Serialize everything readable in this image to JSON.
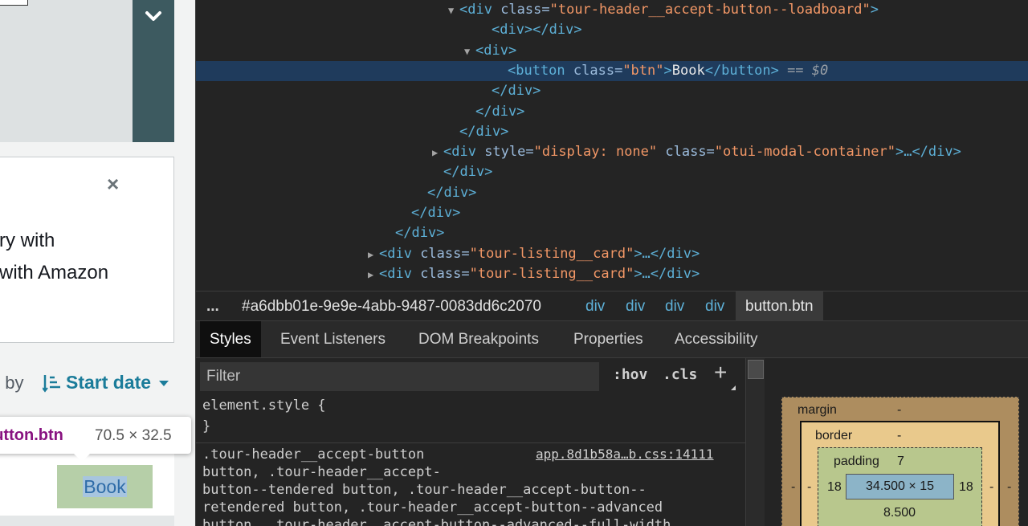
{
  "page": {
    "card": {
      "close_glyph": "×",
      "line1": "ry with",
      "line2": " with Amazon"
    },
    "sort": {
      "label": "t by",
      "value": "Start date"
    },
    "book_button": "Book",
    "tooltip": {
      "element": "button.btn",
      "size": "70.5 × 32.5"
    }
  },
  "devtools": {
    "dom_lines": [
      {
        "tri": "▼",
        "open": "<div",
        "attr": "class",
        "value": "tour-header__accept-button--loadboard",
        "close": ">"
      },
      {
        "raw": "<div></div>"
      },
      {
        "tri": "▼",
        "raw": "<div>"
      },
      {
        "open": "<button",
        "attr": "class",
        "value": "btn",
        "close": ">",
        "text": "Book",
        "end": "</button>",
        "marker": "== $0"
      },
      {
        "raw": "</div>"
      },
      {
        "raw": "</div>"
      },
      {
        "raw": "</div>"
      },
      {
        "tri": "▶",
        "open": "<div",
        "attr": "style",
        "value": "display: none",
        "attr2": "class",
        "value2": "otui-modal-container",
        "close": ">…</div>"
      },
      {
        "raw": "</div>"
      },
      {
        "raw": "</div>"
      },
      {
        "raw": "</div>"
      },
      {
        "raw": "</div>"
      },
      {
        "tri": "▶",
        "open": "<div",
        "attr": "class",
        "value": "tour-listing__card",
        "close": ">…</div>"
      },
      {
        "tri": "▶",
        "open": "<div",
        "attr": "class",
        "value": "tour-listing__card",
        "close": ">…</div>"
      }
    ],
    "ellipsis": "…",
    "breadcrumbs": {
      "more": "...",
      "id": "#a6dbb01e-9e9e-4abb-9487-0083dd6c2070",
      "divs": [
        "div",
        "div",
        "div",
        "div"
      ],
      "active": "button.btn"
    },
    "tabs": [
      "Styles",
      "Event Listeners",
      "DOM Breakpoints",
      "Properties",
      "Accessibility"
    ],
    "styles": {
      "filter_placeholder": "Filter",
      "hov": ":hov",
      "cls": ".cls",
      "plus": "+",
      "element_style_open": "element.style {",
      "element_style_close": "}",
      "selector_lines": [
        ".tour-header__accept-button",
        "button, .tour-header__accept-",
        "button--tendered button, .tour-header__accept-button--",
        "retendered button, .tour-header__accept-button--advanced",
        "button, .tour-header__accept-button--advanced--full-width"
      ],
      "source": "app.8d1b58a…b.css:14111"
    },
    "box_model": {
      "margin_label": "margin",
      "margin_top": "-",
      "margin_left": "-",
      "margin_right": "-",
      "border_label": "border",
      "border_top": "-",
      "border_left": "-",
      "border_right": "-",
      "padding_label": "padding",
      "padding_top": "7",
      "padding_left": "18",
      "padding_right": "18",
      "padding_bottom": "8.500",
      "content": "34.500 × 15"
    }
  }
}
